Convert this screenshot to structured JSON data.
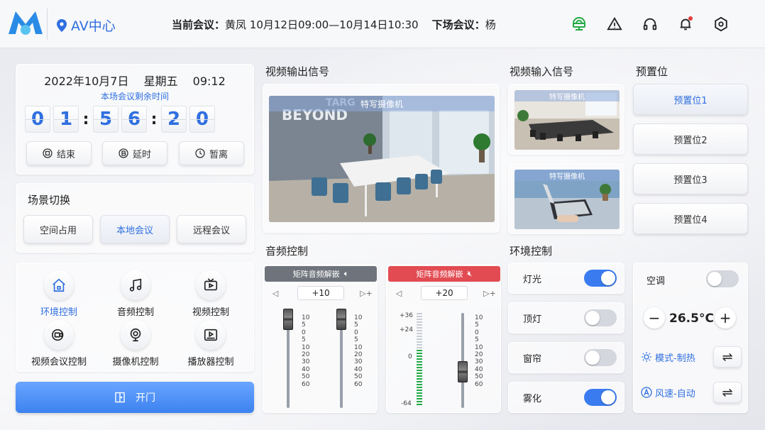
{
  "header": {
    "location": "AV中心",
    "current_label": "当前会议：",
    "current_value": "黄凤  10月12日09:00—10月14日10:30",
    "next_label": "下场会议：",
    "next_value": "杨"
  },
  "timer": {
    "date": "2022年10月7日",
    "weekday": "星期五",
    "time": "09:12",
    "remain_label": "本场会议剩余时间",
    "digits": [
      "0",
      "1",
      "5",
      "6",
      "2",
      "0"
    ],
    "separator": ":",
    "buttons": {
      "end": "结束",
      "extend": "延时",
      "leave": "暂离"
    }
  },
  "scene": {
    "title": "场景切换",
    "buttons": [
      "空间占用",
      "本地会议",
      "远程会议"
    ],
    "selected": "本地会议"
  },
  "functions": [
    {
      "label": "环境控制",
      "active": true
    },
    {
      "label": "音频控制"
    },
    {
      "label": "视频控制"
    },
    {
      "label": "视频会议控制"
    },
    {
      "label": "摄像机控制"
    },
    {
      "label": "播放器控制"
    }
  ],
  "door": {
    "label": "开门"
  },
  "video_out": {
    "title": "视频输出信号",
    "camera_label": "特写摄像机"
  },
  "video_in": {
    "title": "视频输入信号",
    "cams": [
      "特写摄像机",
      "特写摄像机"
    ]
  },
  "presets": {
    "title": "预置位",
    "items": [
      "预置位1",
      "预置位2",
      "预置位3",
      "预置位4"
    ],
    "selected": 0
  },
  "audio": {
    "title": "音频控制",
    "channels": [
      {
        "label": "矩阵音频解嵌",
        "volume": "+10",
        "color": "#6f747c"
      },
      {
        "label": "矩阵音频解嵌",
        "volume": "+20",
        "color": "#e24b52"
      }
    ],
    "scale": [
      "10",
      "5",
      "0",
      "5",
      "10",
      "20",
      "30",
      "40",
      "50",
      "60"
    ],
    "meter_scale": [
      "+36",
      "+24",
      "0",
      "-64"
    ]
  },
  "env": {
    "title": "环境控制",
    "items": [
      {
        "label": "灯光",
        "on": true
      },
      {
        "label": "顶灯",
        "on": false
      },
      {
        "label": "窗帘",
        "on": false
      },
      {
        "label": "雾化",
        "on": true
      }
    ],
    "ac": {
      "label": "空调",
      "on": false,
      "temp": "26.5°C",
      "mode": "模式-制热",
      "fan": "风速-自动",
      "minus": "−",
      "plus": "+",
      "swap": "⇌"
    }
  },
  "colors": {
    "accent": "#2f6fe0",
    "toggle_on": "#3a7bef",
    "green": "#22aa44"
  }
}
